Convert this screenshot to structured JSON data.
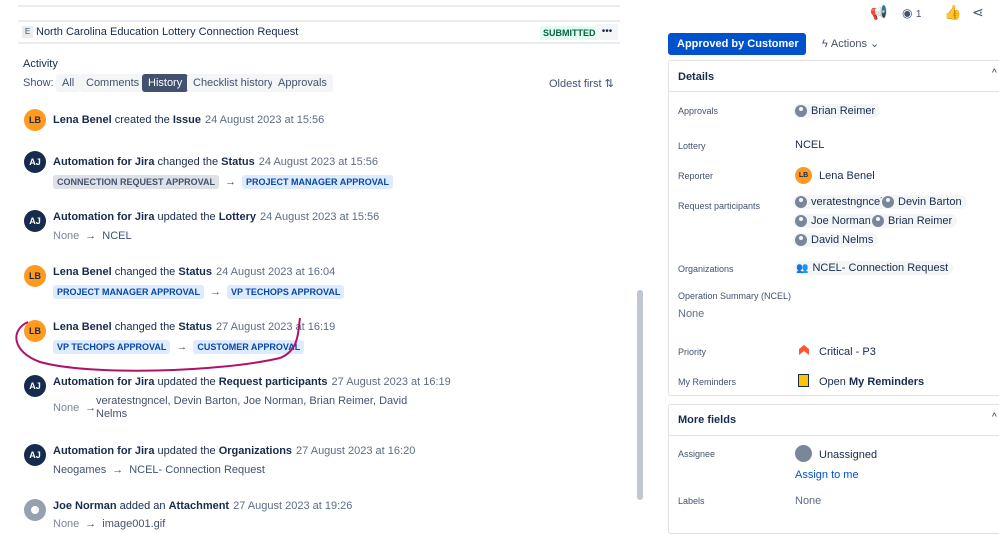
{
  "issue": {
    "type_letter": "E",
    "title": "North Carolina Education Lottery Connection Request",
    "status": "SUBMITTED",
    "more": "•••"
  },
  "activity": {
    "heading": "Activity",
    "show_label": "Show:",
    "filters": [
      "All",
      "Comments",
      "History",
      "Checklist history",
      "Approvals"
    ],
    "sort": "Oldest first",
    "entries": [
      {
        "initials": "LB",
        "actor": "Lena Benel",
        "verb": "created the",
        "field": "Issue",
        "date": "24 August 2023 at 15:56"
      },
      {
        "initials": "AJ",
        "actor": "Automation for Jira",
        "verb": "changed the",
        "field": "Status",
        "date": "24 August 2023 at 15:56",
        "from": "CONNECTION REQUEST APPROVAL",
        "to": "PROJECT MANAGER APPROVAL"
      },
      {
        "initials": "AJ",
        "actor": "Automation for Jira",
        "verb": "updated the",
        "field": "Lottery",
        "date": "24 August 2023 at 15:56",
        "from": "None",
        "to": "NCEL"
      },
      {
        "initials": "LB",
        "actor": "Lena Benel",
        "verb": "changed the",
        "field": "Status",
        "date": "24 August 2023 at 16:04",
        "from": "PROJECT MANAGER APPROVAL",
        "to": "VP TECHOPS APPROVAL"
      },
      {
        "initials": "LB",
        "actor": "Lena Benel",
        "verb": "changed the",
        "field": "Status",
        "date": "27 August 2023 at 16:19",
        "from": "VP TECHOPS APPROVAL",
        "to": "CUSTOMER APPROVAL"
      },
      {
        "initials": "AJ",
        "actor": "Automation for Jira",
        "verb": "updated the",
        "field": "Request participants",
        "date": "27 August 2023 at 16:19",
        "from": "None",
        "to": "veratestngncel, Devin Barton, Joe Norman, Brian Reimer, David",
        "to2": "Nelms"
      },
      {
        "initials": "AJ",
        "actor": "Automation for Jira",
        "verb": "updated the",
        "field": "Organizations",
        "date": "27 August 2023 at 16:20",
        "from": "Neogames",
        "to": "NCEL- Connection Request"
      },
      {
        "initials": "",
        "actor": "Joe Norman",
        "verb": "added an",
        "field": "Attachment",
        "date": "27 August 2023 at 19:26",
        "from": "None",
        "to": "image001.gif"
      }
    ]
  },
  "header": {
    "watchers": "1",
    "status_button": "Approved by Customer",
    "actions": "Actions"
  },
  "details": {
    "title": "Details",
    "approvals_label": "Approvals",
    "approvals": "Brian Reimer",
    "lottery_label": "Lottery",
    "lottery": "NCEL",
    "reporter_label": "Reporter",
    "reporter_initials": "LB",
    "reporter": "Lena Benel",
    "participants_label": "Request participants",
    "participants": [
      "veratestngncel",
      "Devin Barton",
      "Joe Norman",
      "Brian Reimer",
      "David Nelms"
    ],
    "orgs_label": "Organizations",
    "orgs": "NCEL- Connection Request",
    "opsum_label": "Operation Summary (NCEL)",
    "opsum": "None",
    "priority_label": "Priority",
    "priority": "Critical - P3",
    "reminders_label": "My Reminders",
    "reminders_prefix": "Open",
    "reminders": "My Reminders"
  },
  "more_fields": {
    "title": "More fields",
    "assignee_label": "Assignee",
    "assignee": "Unassigned",
    "assign_me": "Assign to me",
    "labels_label": "Labels",
    "labels": "None"
  },
  "colors": {
    "accent": "#0052cc",
    "annotation": "#b0126a"
  }
}
